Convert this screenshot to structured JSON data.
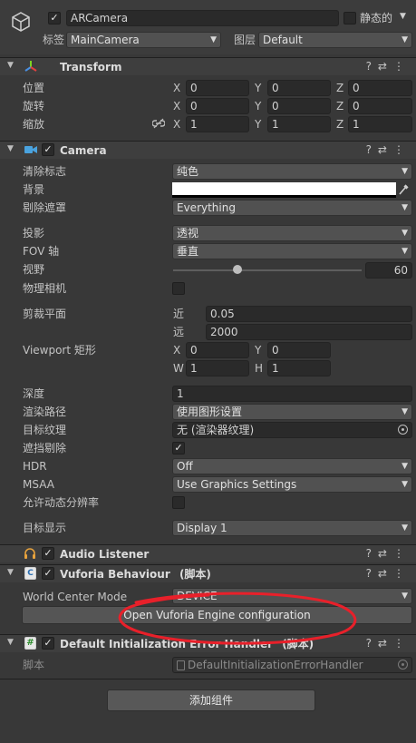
{
  "object": {
    "active_checked": true,
    "name": "ARCamera",
    "static_label": "静态的",
    "tag_label": "标签",
    "tag_value": "MainCamera",
    "layer_label": "图层",
    "layer_value": "Default"
  },
  "transform": {
    "title": "Transform",
    "position_label": "位置",
    "rotation_label": "旋转",
    "scale_label": "缩放",
    "axis_x": "X",
    "axis_y": "Y",
    "axis_z": "Z",
    "position": {
      "x": "0",
      "y": "0",
      "z": "0"
    },
    "rotation": {
      "x": "0",
      "y": "0",
      "z": "0"
    },
    "scale": {
      "x": "1",
      "y": "1",
      "z": "1"
    }
  },
  "camera": {
    "title": "Camera",
    "clear_flags_label": "清除标志",
    "clear_flags_value": "纯色",
    "background_label": "背景",
    "culling_mask_label": "剔除遮罩",
    "culling_mask_value": "Everything",
    "projection_label": "投影",
    "projection_value": "透视",
    "fov_axis_label": "FOV 轴",
    "fov_axis_value": "垂直",
    "fov_label": "视野",
    "fov_value": "60",
    "fov_slider_fraction": 0.4,
    "physical_camera_label": "物理相机",
    "clipping_label": "剪裁平面",
    "near_label": "近",
    "near_value": "0.05",
    "far_label": "远",
    "far_value": "2000",
    "viewport_label": "Viewport 矩形",
    "vp_x": "0",
    "vp_y": "0",
    "vp_w": "1",
    "vp_h": "1",
    "w_label": "W",
    "h_label": "H",
    "depth_label": "深度",
    "depth_value": "1",
    "render_path_label": "渲染路径",
    "render_path_value": "使用图形设置",
    "target_texture_label": "目标纹理",
    "target_texture_value": "无 (渲染器纹理)",
    "occlusion_label": "遮挡剔除",
    "hdr_label": "HDR",
    "hdr_value": "Off",
    "msaa_label": "MSAA",
    "msaa_value": "Use Graphics Settings",
    "dynamic_res_label": "允许动态分辨率",
    "target_display_label": "目标显示",
    "target_display_value": "Display 1"
  },
  "audio_listener": {
    "title": "Audio Listener"
  },
  "vuforia": {
    "title": "Vuforia Behaviour",
    "title_suffix": "(脚本)",
    "world_center_label": "World Center Mode",
    "world_center_value": "DEVICE",
    "config_button": "Open Vuforia Engine configuration"
  },
  "error_handler": {
    "title": "Default Initialization Error Handler",
    "title_suffix": "(脚本)",
    "script_label": "脚本",
    "script_value": "DefaultInitializationErrorHandler"
  },
  "add_component": "添加组件",
  "colors": {
    "annotation": "#e8202a",
    "panel": "#383838",
    "header": "#3e3e3e",
    "field": "#2a2a2a"
  }
}
